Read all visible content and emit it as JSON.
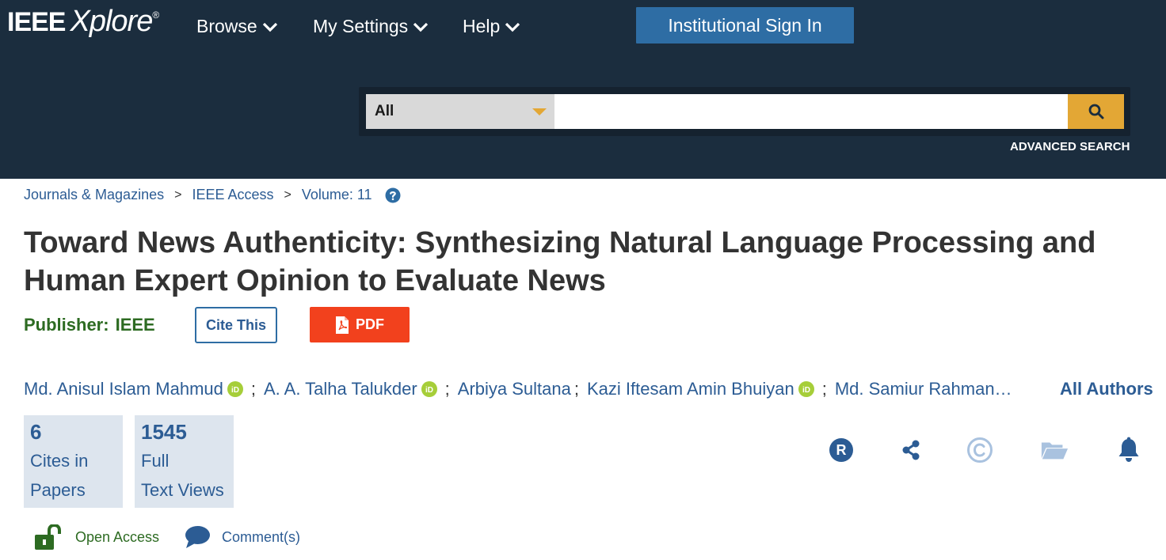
{
  "header": {
    "logo_ieee": "IEEE",
    "logo_xplore": "Xplore",
    "logo_reg": "®",
    "nav": [
      {
        "label": "Browse"
      },
      {
        "label": "My Settings"
      },
      {
        "label": "Help"
      }
    ],
    "signin_label": "Institutional Sign In",
    "search": {
      "scope_value": "All",
      "query_value": "",
      "placeholder": "",
      "button_icon": "search-icon"
    },
    "advanced_search_label": "ADVANCED SEARCH"
  },
  "breadcrumb": {
    "items": [
      "Journals & Magazines",
      "IEEE Access",
      "Volume: 11"
    ],
    "separator": ">",
    "help_icon": "question-circle-icon"
  },
  "article": {
    "title": "Toward News Authenticity: Synthesizing Natural Language Processing and Human Expert Opinion to Evaluate News",
    "publisher_label": "Publisher:",
    "publisher_name": "IEEE",
    "cite_label": "Cite This",
    "pdf_label": "PDF",
    "authors": [
      {
        "name": "Md. Anisul Islam Mahmud",
        "orcid": true
      },
      {
        "name": "A. A. Talha Talukder",
        "orcid": true
      },
      {
        "name": "Arbiya Sultana",
        "orcid": false
      },
      {
        "name": "Kazi Iftesam Amin Bhuiyan",
        "orcid": true
      },
      {
        "name": "Md. Samiur Rahman…",
        "orcid": false
      }
    ],
    "author_separator": ";",
    "all_authors_label": "All Authors"
  },
  "metrics": [
    {
      "value": "6",
      "line1": "Cites in",
      "line2": "Papers"
    },
    {
      "value": "1545",
      "line1": "Full",
      "line2": "Text Views"
    }
  ],
  "tools": [
    {
      "icon": "rights-r-icon"
    },
    {
      "icon": "share-icon"
    },
    {
      "icon": "copyright-icon"
    },
    {
      "icon": "folder-icon"
    },
    {
      "icon": "bell-icon"
    }
  ],
  "footer": {
    "open_access_label": "Open Access",
    "comments_label": "Comment(s)"
  },
  "colors": {
    "header_bg": "#1b2d3e",
    "signin_bg": "#2e6da4",
    "search_button": "#e3a735",
    "link_blue": "#2c5c94",
    "publisher_green": "#2d6b22",
    "pdf_red": "#f2411d",
    "metric_bg": "#dde5ee",
    "orcid_green": "#a6ce39"
  }
}
